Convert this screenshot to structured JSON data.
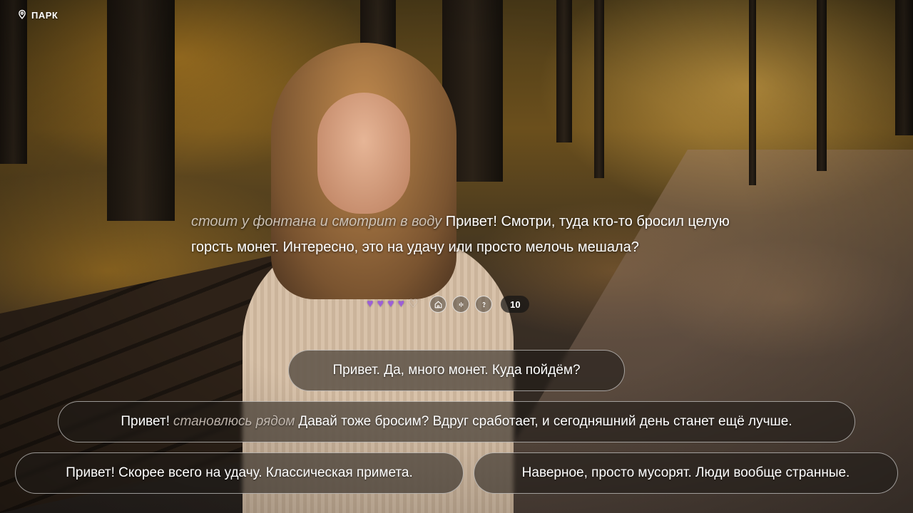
{
  "location": {
    "icon": "location-pin-icon",
    "label": "ПАРК"
  },
  "dialogue": {
    "action": "стоит у фонтана и смотрит в воду",
    "speech": "Привет! Смотри, туда кто-то бросил целую горсть монет. Интересно, это на удачу или просто мелочь мешала?"
  },
  "status": {
    "hearts_filled": 4,
    "hearts_total": 5,
    "heart_color": "#9c5fd8",
    "counter": "10",
    "icons": [
      "home-icon",
      "voice-icon",
      "help-icon"
    ]
  },
  "choices": [
    {
      "text": "Привет. Да, много монет. Куда пойдём?"
    },
    {
      "pre": "Привет!",
      "action": "становлюсь рядом",
      "post": "Давай тоже бросим? Вдруг сработает, и сегодняшний день станет ещё лучше."
    },
    {
      "text": "Привет! Скорее всего на удачу. Классическая примета."
    },
    {
      "text": "Наверное, просто мусорят. Люди вообще странные."
    }
  ]
}
